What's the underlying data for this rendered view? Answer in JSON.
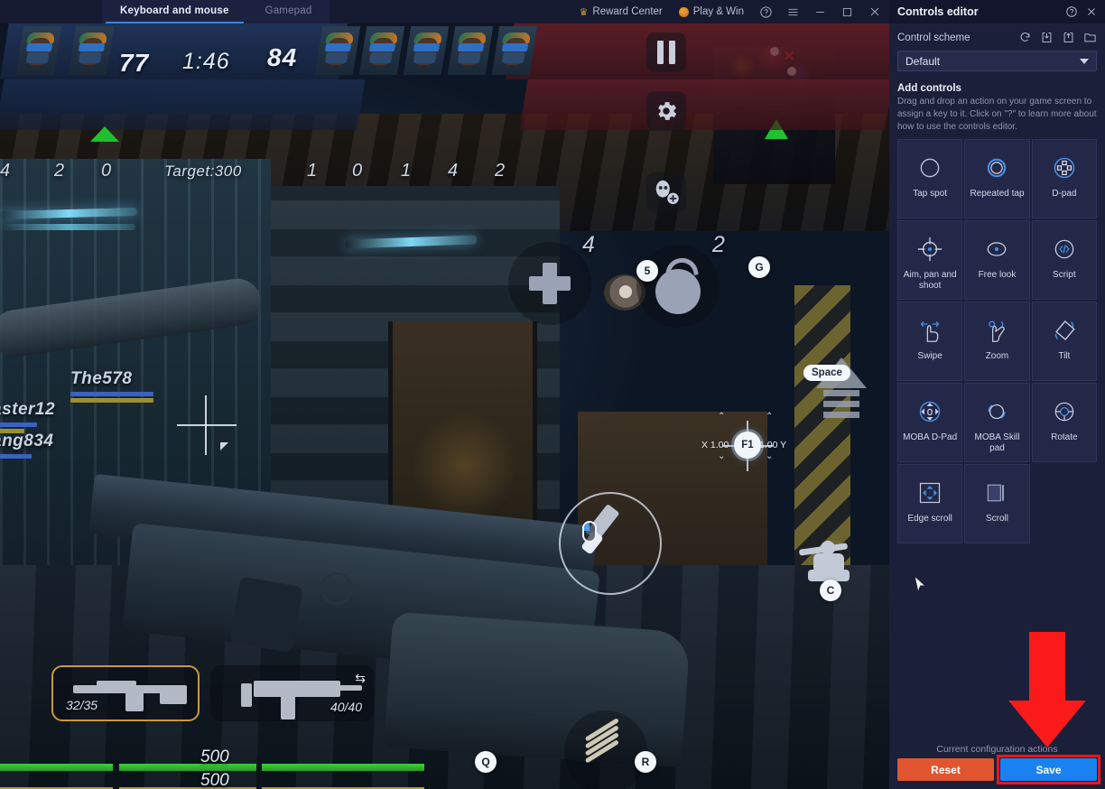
{
  "titlebar": {
    "tabs": [
      {
        "label": "Keyboard and mouse",
        "active": true
      },
      {
        "label": "Gamepad",
        "active": false
      }
    ],
    "reward_center": "Reward Center",
    "play_and_win": "Play & Win",
    "help_icon": "help-icon",
    "menu_icon": "hamburger-menu-icon",
    "minimize_icon": "minimize-icon",
    "maximize_icon": "maximize-icon",
    "close_icon": "close-icon"
  },
  "game": {
    "scoreboard": {
      "team_a_score": "77",
      "team_b_score": "84",
      "timer": "1:46",
      "target": "Target:300",
      "team_a_stats": [
        "4",
        "2",
        "0"
      ],
      "team_b_stats": [
        "1",
        "0",
        "1",
        "4",
        "2"
      ]
    },
    "nametags": [
      {
        "name": "The578"
      },
      {
        "name": "aster12"
      },
      {
        "name": "ang834"
      }
    ],
    "items": [
      {
        "icon": "medkit-icon",
        "count": ""
      },
      {
        "icon": "flashbang-icon",
        "count": "4"
      },
      {
        "icon": "grenade-icon",
        "count": "2"
      }
    ],
    "key_markers": [
      {
        "key": "5",
        "name": "key-marker-5"
      },
      {
        "key": "G",
        "name": "key-marker-g"
      },
      {
        "key": "C",
        "name": "key-marker-c"
      },
      {
        "key": "Q",
        "name": "key-marker-q"
      },
      {
        "key": "R",
        "name": "key-marker-r"
      }
    ],
    "space_key": "Space",
    "aim_control": {
      "key": "F1",
      "x_label": "X 1.00",
      "y_label": "1.00 Y"
    },
    "weapons": [
      {
        "ammo": "32/35",
        "selected": true,
        "icon": "assault-rifle-icon"
      },
      {
        "ammo": "40/40",
        "selected": false,
        "icon": "smg-icon"
      }
    ],
    "health": {
      "value": "500",
      "armor": "500"
    },
    "right_icons": [
      "pause-icon",
      "settings-gear-icon",
      "add-friend-icon"
    ]
  },
  "sidebar": {
    "title": "Controls editor",
    "help_icon": "help-icon",
    "close_icon": "close-icon",
    "control_scheme_label": "Control scheme",
    "scheme_icons": [
      "reset-scheme-icon",
      "import-scheme-icon",
      "export-scheme-icon",
      "folder-icon"
    ],
    "scheme_value": "Default",
    "add_controls_title": "Add controls",
    "add_controls_desc": "Drag and drop an action on your game screen to assign a key to it. Click on \"?\" to learn more about how to use the controls editor.",
    "controls": [
      {
        "label": "Tap spot",
        "icon": "tap-spot-icon"
      },
      {
        "label": "Repeated tap",
        "icon": "repeated-tap-icon"
      },
      {
        "label": "D-pad",
        "icon": "d-pad-icon"
      },
      {
        "label": "Aim, pan and shoot",
        "icon": "aim-pan-shoot-icon"
      },
      {
        "label": "Free look",
        "icon": "free-look-icon"
      },
      {
        "label": "Script",
        "icon": "script-icon"
      },
      {
        "label": "Swipe",
        "icon": "swipe-icon"
      },
      {
        "label": "Zoom",
        "icon": "zoom-icon"
      },
      {
        "label": "Tilt",
        "icon": "tilt-icon"
      },
      {
        "label": "MOBA D-Pad",
        "icon": "moba-dpad-icon"
      },
      {
        "label": "MOBA Skill pad",
        "icon": "moba-skill-pad-icon"
      },
      {
        "label": "Rotate",
        "icon": "rotate-icon"
      },
      {
        "label": "Edge scroll",
        "icon": "edge-scroll-icon"
      },
      {
        "label": "Scroll",
        "icon": "scroll-icon"
      }
    ],
    "current_config_label": "Current configuration actions",
    "reset_button": "Reset",
    "save_button": "Save",
    "colors": {
      "panel_bg": "#1b1f3a",
      "card_bg": "#232848",
      "reset": "#e0552f",
      "save": "#1a82f0",
      "highlight": "#f11515"
    }
  }
}
